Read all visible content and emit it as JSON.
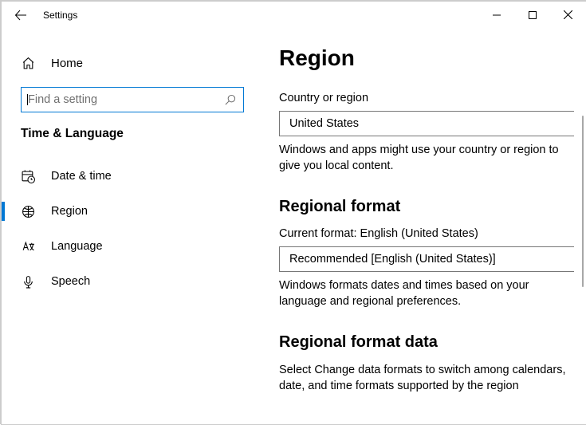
{
  "window": {
    "title": "Settings"
  },
  "sidebar": {
    "home": "Home",
    "search_placeholder": "Find a setting",
    "section": "Time & Language",
    "items": [
      {
        "label": "Date & time"
      },
      {
        "label": "Region"
      },
      {
        "label": "Language"
      },
      {
        "label": "Speech"
      }
    ]
  },
  "main": {
    "title": "Region",
    "country_label": "Country or region",
    "country_value": "United States",
    "country_desc": "Windows and apps might use your country or region to give you local content.",
    "format_heading": "Regional format",
    "format_current_label": "Current format: English (United States)",
    "format_value": "Recommended [English (United States)]",
    "format_desc": "Windows formats dates and times based on your language and regional preferences.",
    "data_heading": "Regional format data",
    "data_desc": "Select Change data formats to switch among calendars, date, and time formats supported by the region"
  }
}
